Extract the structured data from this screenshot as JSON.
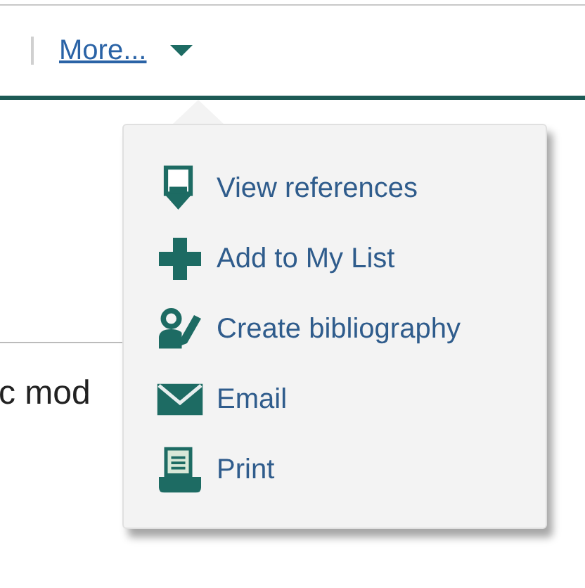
{
  "toolbar": {
    "link": "More...",
    "expanded": true
  },
  "background_text": "c mod",
  "menu": {
    "items": [
      {
        "label": "View references"
      },
      {
        "label": "Add to My List"
      },
      {
        "label": "Create bibliography"
      },
      {
        "label": "Email"
      },
      {
        "label": "Print"
      }
    ]
  }
}
